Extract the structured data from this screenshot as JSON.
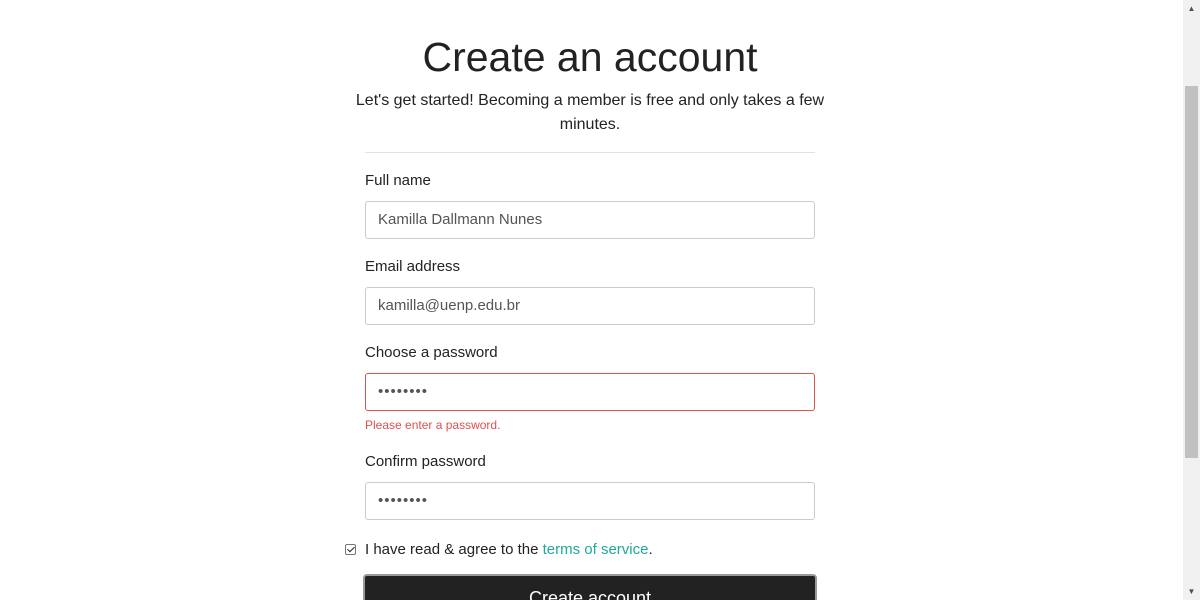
{
  "form": {
    "title": "Create an account",
    "subtitle": "Let's get started! Becoming a member is free and only takes a few minutes.",
    "full_name": {
      "label": "Full name",
      "value": "Kamilla Dallmann Nunes"
    },
    "email": {
      "label": "Email address",
      "value": "kamilla@uenp.edu.br"
    },
    "password": {
      "label": "Choose a password",
      "value": "••••••••",
      "error": "Please enter a password."
    },
    "confirm_password": {
      "label": "Confirm password",
      "value": "••••••••"
    },
    "terms": {
      "text_before": "I have read & agree to the ",
      "link": "terms of service",
      "text_after": ".",
      "checked": true
    },
    "submit_label": "Create account"
  },
  "colors": {
    "accent_link": "#20a89a",
    "error": "#d9534f",
    "button_bg": "#222222"
  },
  "scrollbar": {
    "up_icon": "triangle-up-icon",
    "down_icon": "triangle-down-icon"
  }
}
